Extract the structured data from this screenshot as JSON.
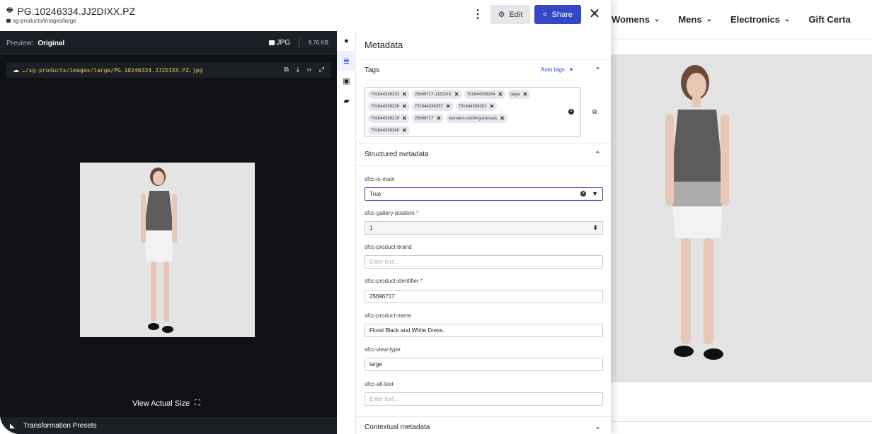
{
  "store": {
    "nav": [
      {
        "label": "Womens"
      },
      {
        "label": "Mens"
      },
      {
        "label": "Electronics"
      },
      {
        "label": "Gift Certa"
      }
    ]
  },
  "header": {
    "title": "PG.10246334.JJ2DIXX.PZ",
    "path": "sg-products/images/large",
    "edit_label": "Edit",
    "share_label": "Share"
  },
  "preview": {
    "label": "Preview:",
    "mode": "Original",
    "format": "JPG",
    "size": "9.76 KB",
    "url": "…/sg-products/images/large/PG.10246334.JJ2DIXX.PZ.jpg",
    "view_actual": "View Actual Size",
    "transformation_presets": "Transformation Presets"
  },
  "metadata": {
    "title": "Metadata",
    "tags_title": "Tags",
    "auto_tags_label": "Auto tags",
    "tags_rows": [
      [
        "701644336233",
        "25696717-JJ2DIXX",
        "701644336264",
        "large"
      ],
      [
        "701644336226",
        "701644336257",
        "701644336202"
      ],
      [
        "701644336219",
        "25696717",
        "womens-clothing-dresses"
      ],
      [
        "701644336240"
      ]
    ],
    "structured_title": "Structured metadata",
    "fields": {
      "is_main": {
        "label": "sfcc-is-main",
        "value": "True"
      },
      "gallery_position": {
        "label": "sfcc-gallery-position",
        "value": "1"
      },
      "product_brand": {
        "label": "sfcc-product-brand",
        "placeholder": "Enter text..."
      },
      "product_identifier": {
        "label": "sfcc-product-identifier",
        "value": "25696717"
      },
      "product_name": {
        "label": "sfcc-product-name",
        "value": "Floral Black and White Dress."
      },
      "view_type": {
        "label": "sfcc-view-type",
        "value": "large"
      },
      "alt_text": {
        "label": "sfcc-alt-text",
        "placeholder": "Enter text..."
      }
    },
    "required_mark": "*",
    "contextual_title": "Contextual metadata"
  },
  "colors": {
    "accent": "#3448c5",
    "preview_bg": "#0f1115",
    "url_text": "#e6c84b",
    "required": "#d6303c"
  }
}
